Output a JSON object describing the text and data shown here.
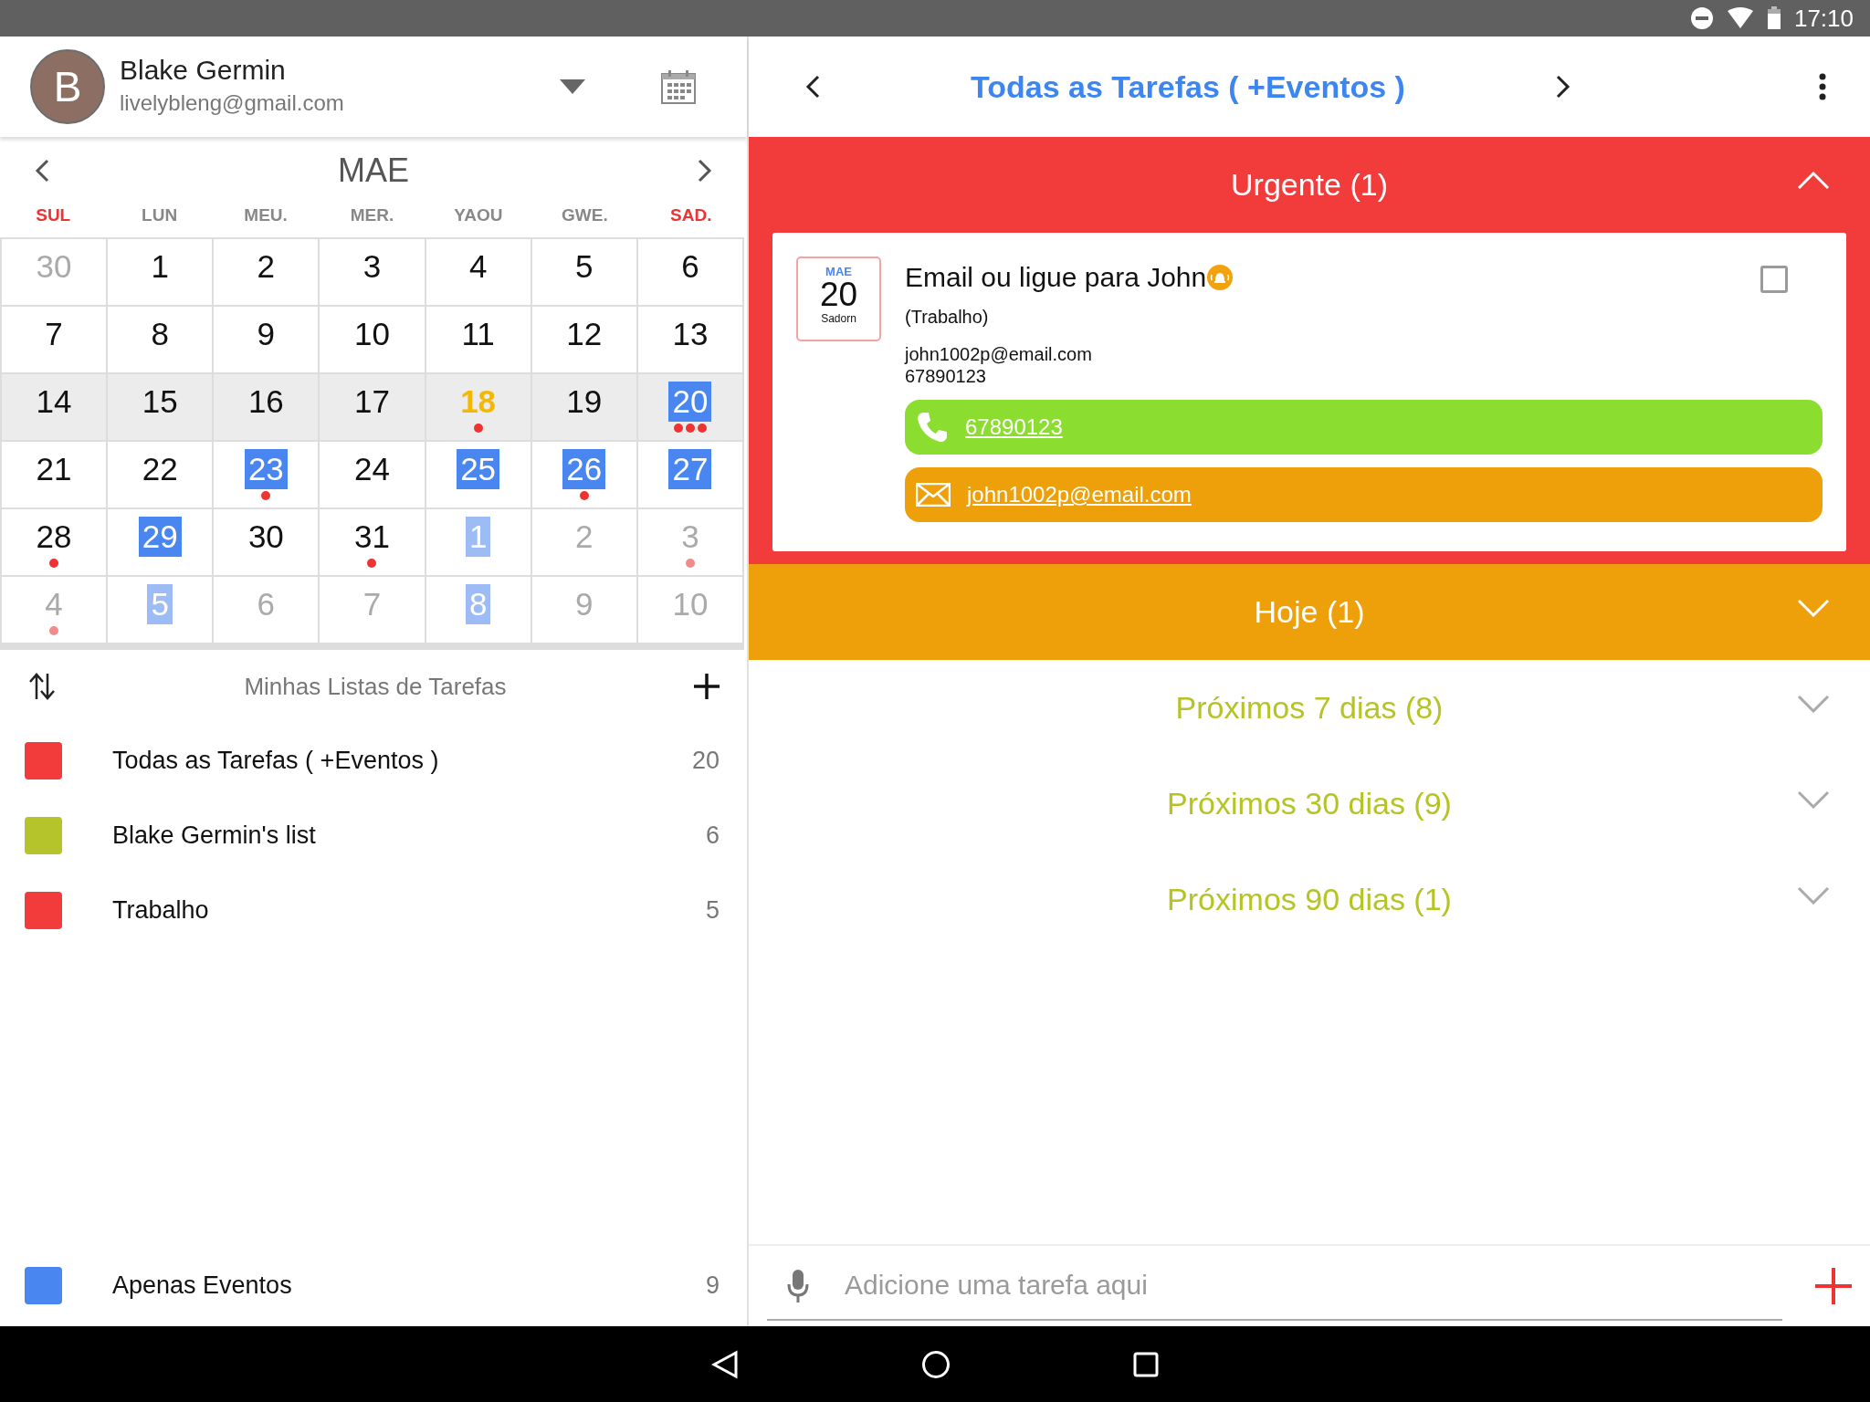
{
  "status_bar": {
    "time": "17:10"
  },
  "account": {
    "avatar_letter": "B",
    "name": "Blake Germin",
    "email": "livelybleng@gmail.com"
  },
  "calendar": {
    "month": "MAE",
    "weekdays": [
      {
        "label": "SUL",
        "weekend": true
      },
      {
        "label": "LUN",
        "weekend": false
      },
      {
        "label": "MEU.",
        "weekend": false
      },
      {
        "label": "MER.",
        "weekend": false
      },
      {
        "label": "YAOU",
        "weekend": false
      },
      {
        "label": "GWE.",
        "weekend": false
      },
      {
        "label": "SAD.",
        "weekend": true
      }
    ],
    "weeks": [
      {
        "selected": false,
        "days": [
          {
            "day": "30",
            "muted": true,
            "highlight": false,
            "today": false
          },
          {
            "day": "1",
            "muted": false,
            "highlight": false,
            "today": false
          },
          {
            "day": "2",
            "muted": false,
            "highlight": false,
            "today": false
          },
          {
            "day": "3",
            "muted": false,
            "highlight": false,
            "today": false
          },
          {
            "day": "4",
            "muted": false,
            "highlight": false,
            "today": false
          },
          {
            "day": "5",
            "muted": false,
            "highlight": false,
            "today": false
          },
          {
            "day": "6",
            "muted": false,
            "highlight": false,
            "today": false
          }
        ]
      },
      {
        "selected": false,
        "days": [
          {
            "day": "7",
            "muted": false,
            "highlight": false,
            "today": false
          },
          {
            "day": "8",
            "muted": false,
            "highlight": false,
            "today": false
          },
          {
            "day": "9",
            "muted": false,
            "highlight": false,
            "today": false
          },
          {
            "day": "10",
            "muted": false,
            "highlight": false,
            "today": false
          },
          {
            "day": "11",
            "muted": false,
            "highlight": false,
            "today": false
          },
          {
            "day": "12",
            "muted": false,
            "highlight": false,
            "today": false
          },
          {
            "day": "13",
            "muted": false,
            "highlight": false,
            "today": false
          }
        ]
      },
      {
        "selected": true,
        "days": [
          {
            "day": "14",
            "muted": false,
            "highlight": false,
            "today": false
          },
          {
            "day": "15",
            "muted": false,
            "highlight": false,
            "today": false
          },
          {
            "day": "16",
            "muted": false,
            "highlight": false,
            "today": false
          },
          {
            "day": "17",
            "muted": false,
            "highlight": false,
            "today": false
          },
          {
            "day": "18",
            "muted": false,
            "highlight": false,
            "today": true,
            "dots": [
              {
                "color": "#ee3333"
              }
            ]
          },
          {
            "day": "19",
            "muted": false,
            "highlight": false,
            "today": false
          },
          {
            "day": "20",
            "muted": false,
            "highlight": true,
            "today": false,
            "dots": [
              {
                "color": "#ee3333"
              },
              {
                "color": "#ee3333"
              },
              {
                "color": "#ee3333"
              }
            ]
          }
        ]
      },
      {
        "selected": false,
        "days": [
          {
            "day": "21",
            "muted": false,
            "highlight": false,
            "today": false
          },
          {
            "day": "22",
            "muted": false,
            "highlight": false,
            "today": false
          },
          {
            "day": "23",
            "muted": false,
            "highlight": true,
            "today": false,
            "dots": [
              {
                "color": "#ee3333"
              }
            ]
          },
          {
            "day": "24",
            "muted": false,
            "highlight": false,
            "today": false
          },
          {
            "day": "25",
            "muted": false,
            "highlight": true,
            "today": false
          },
          {
            "day": "26",
            "muted": false,
            "highlight": true,
            "today": false,
            "dots": [
              {
                "color": "#ee3333"
              }
            ]
          },
          {
            "day": "27",
            "muted": false,
            "highlight": true,
            "today": false
          }
        ]
      },
      {
        "selected": false,
        "days": [
          {
            "day": "28",
            "muted": false,
            "highlight": false,
            "today": false,
            "dots": [
              {
                "color": "#ee3333"
              }
            ]
          },
          {
            "day": "29",
            "muted": false,
            "highlight": true,
            "today": false
          },
          {
            "day": "30",
            "muted": false,
            "highlight": false,
            "today": false
          },
          {
            "day": "31",
            "muted": false,
            "highlight": false,
            "today": false,
            "dots": [
              {
                "color": "#ee3333"
              }
            ]
          },
          {
            "day": "1",
            "muted": true,
            "highlight": true,
            "today": false
          },
          {
            "day": "2",
            "muted": true,
            "highlight": false,
            "today": false
          },
          {
            "day": "3",
            "muted": true,
            "highlight": false,
            "today": false,
            "dots": [
              {
                "color": "#f08c8c"
              }
            ]
          }
        ]
      },
      {
        "selected": false,
        "days": [
          {
            "day": "4",
            "muted": true,
            "highlight": false,
            "today": false,
            "dots": [
              {
                "color": "#f08c8c"
              }
            ]
          },
          {
            "day": "5",
            "muted": true,
            "highlight": true,
            "today": false
          },
          {
            "day": "6",
            "muted": true,
            "highlight": false,
            "today": false
          },
          {
            "day": "7",
            "muted": true,
            "highlight": false,
            "today": false
          },
          {
            "day": "8",
            "muted": true,
            "highlight": true,
            "today": false
          },
          {
            "day": "9",
            "muted": true,
            "highlight": false,
            "today": false
          },
          {
            "day": "10",
            "muted": true,
            "highlight": false,
            "today": false
          }
        ]
      }
    ]
  },
  "task_lists": {
    "title": "Minhas Listas de Tarefas",
    "items": [
      {
        "name": "Todas as Tarefas ( +Eventos )",
        "count": "20",
        "color": "#f23c3c"
      },
      {
        "name": "Blake Germin's list",
        "count": "6",
        "color": "#b5c42a"
      },
      {
        "name": "Trabalho",
        "count": "5",
        "color": "#f23c3c"
      }
    ],
    "footer_item": {
      "name": "Apenas Eventos",
      "count": "9",
      "color": "#4a86f0"
    }
  },
  "main": {
    "title": "Todas as Tarefas ( +Eventos )",
    "sections": [
      {
        "title": "Urgente (1)",
        "kind": "filled",
        "color": "#f23c3c",
        "expanded": true,
        "tasks": [
          {
            "date": {
              "month": "MAE",
              "day": "20",
              "weekday": "Sadorn"
            },
            "title": "Email ou ligue para John",
            "alarm": true,
            "category": "(Trabalho)",
            "lines": [
              "john1002p@email.com",
              "67890123"
            ],
            "checked": false,
            "actions": [
              {
                "kind": "phone",
                "label": "67890123",
                "color": "#8bdd2f"
              },
              {
                "kind": "email",
                "label": "john1002p@email.com",
                "color": "#eea00a"
              }
            ]
          }
        ]
      },
      {
        "title": "Hoje (1)",
        "kind": "filled",
        "color": "#eea00a",
        "expanded": false
      },
      {
        "title": "Próximos 7 dias (8)",
        "kind": "plain",
        "color": "#b5c424",
        "expanded": false
      },
      {
        "title": "Próximos 30 dias (9)",
        "kind": "plain",
        "color": "#b5c424",
        "expanded": false
      },
      {
        "title": "Próximos 90 dias (1)",
        "kind": "plain",
        "color": "#b5c424",
        "expanded": false
      }
    ],
    "input": {
      "placeholder": "Adicione uma tarefa aqui"
    }
  }
}
